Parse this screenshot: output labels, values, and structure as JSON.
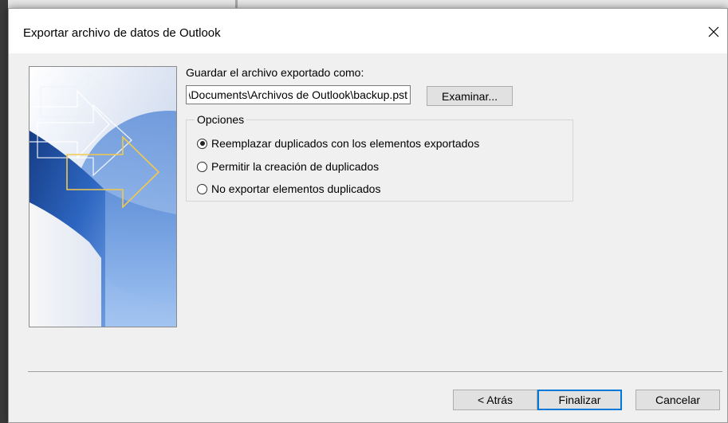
{
  "dialog": {
    "title": "Exportar archivo de datos de Outlook",
    "close_icon": "close-icon"
  },
  "save": {
    "label": "Guardar el archivo exportado como:",
    "path_value": "C:\\Users\\Documents\\Archivos de Outlook\\backup.pst",
    "browse_label": "Examinar..."
  },
  "options": {
    "legend": "Opciones",
    "items": [
      {
        "label": "Reemplazar duplicados con los elementos exportados",
        "checked": true
      },
      {
        "label": "Permitir la creación de duplicados",
        "checked": false
      },
      {
        "label": "No exportar elementos duplicados",
        "checked": false
      }
    ]
  },
  "buttons": {
    "back": "< Atrás",
    "finish": "Finalizar",
    "cancel": "Cancelar"
  },
  "colors": {
    "accent": "#0078d7",
    "wizard_blue": "#1e4fa0",
    "arrow_yellow": "#f2c94c"
  }
}
